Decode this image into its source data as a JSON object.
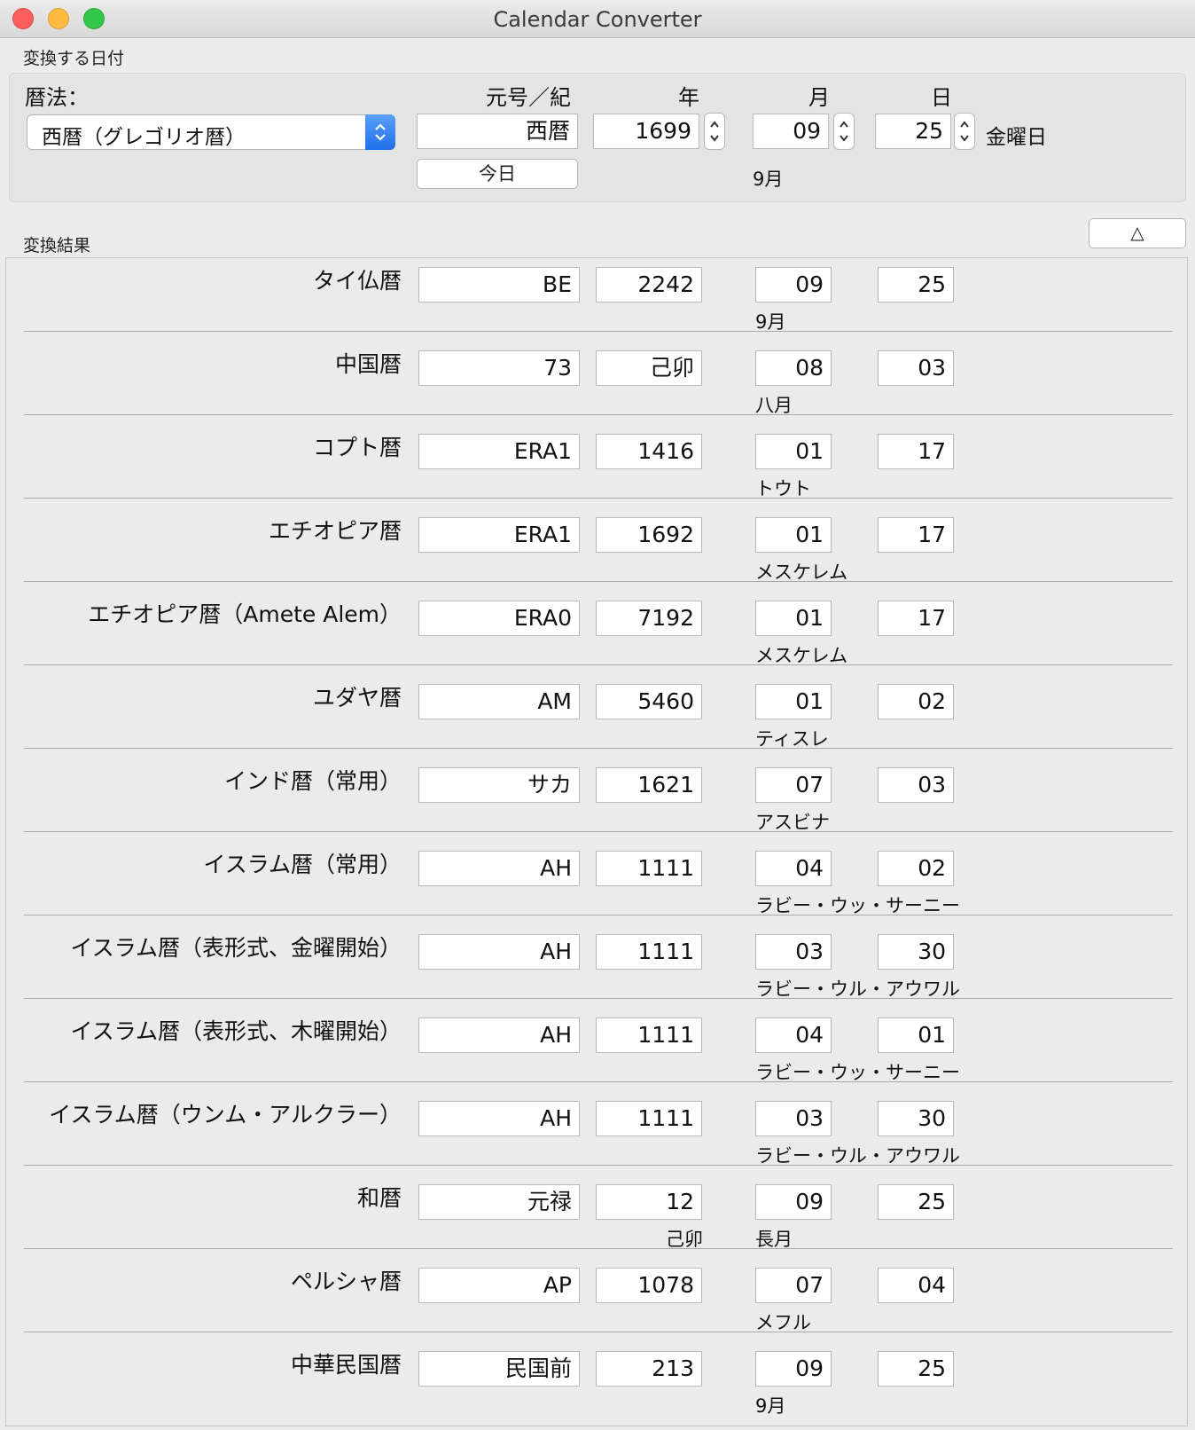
{
  "window": {
    "title": "Calendar Converter"
  },
  "input": {
    "section_label": "変換する日付",
    "calendar_label": "暦法：",
    "era_header": "元号／紀",
    "year_header": "年",
    "month_header": "月",
    "day_header": "日",
    "calendar_selected": "西暦（グレゴリオ暦）",
    "era": "西暦",
    "year": "1699",
    "month": "09",
    "day": "25",
    "weekday": "金曜日",
    "today_button": "今日",
    "month_name": "9月"
  },
  "results": {
    "section_label": "変換結果",
    "collapse_button": "△",
    "rows": [
      {
        "name": "タイ仏暦",
        "era": "BE",
        "year": "2242",
        "month": "09",
        "day": "25",
        "month_name": "9月",
        "year_sub": ""
      },
      {
        "name": "中国暦",
        "era": "73",
        "year": "己卯",
        "month": "08",
        "day": "03",
        "month_name": "八月",
        "year_sub": ""
      },
      {
        "name": "コプト暦",
        "era": "ERA1",
        "year": "1416",
        "month": "01",
        "day": "17",
        "month_name": "トウト",
        "year_sub": ""
      },
      {
        "name": "エチオピア暦",
        "era": "ERA1",
        "year": "1692",
        "month": "01",
        "day": "17",
        "month_name": "メスケレム",
        "year_sub": ""
      },
      {
        "name": "エチオピア暦（Amete Alem）",
        "era": "ERA0",
        "year": "7192",
        "month": "01",
        "day": "17",
        "month_name": "メスケレム",
        "year_sub": ""
      },
      {
        "name": "ユダヤ暦",
        "era": "AM",
        "year": "5460",
        "month": "01",
        "day": "02",
        "month_name": "ティスレ",
        "year_sub": ""
      },
      {
        "name": "インド暦（常用）",
        "era": "サカ",
        "year": "1621",
        "month": "07",
        "day": "03",
        "month_name": "アスビナ",
        "year_sub": ""
      },
      {
        "name": "イスラム暦（常用）",
        "era": "AH",
        "year": "1111",
        "month": "04",
        "day": "02",
        "month_name": "ラビー・ウッ・サーニー",
        "year_sub": ""
      },
      {
        "name": "イスラム暦（表形式、金曜開始）",
        "era": "AH",
        "year": "1111",
        "month": "03",
        "day": "30",
        "month_name": "ラビー・ウル・アウワル",
        "year_sub": ""
      },
      {
        "name": "イスラム暦（表形式、木曜開始）",
        "era": "AH",
        "year": "1111",
        "month": "04",
        "day": "01",
        "month_name": "ラビー・ウッ・サーニー",
        "year_sub": ""
      },
      {
        "name": "イスラム暦（ウンム・アルクラー）",
        "era": "AH",
        "year": "1111",
        "month": "03",
        "day": "30",
        "month_name": "ラビー・ウル・アウワル",
        "year_sub": ""
      },
      {
        "name": "和暦",
        "era": "元禄",
        "year": "12",
        "month": "09",
        "day": "25",
        "month_name": "長月",
        "year_sub": "己卯"
      },
      {
        "name": "ペルシャ暦",
        "era": "AP",
        "year": "1078",
        "month": "07",
        "day": "04",
        "month_name": "メフル",
        "year_sub": ""
      },
      {
        "name": "中華民国暦",
        "era": "民国前",
        "year": "213",
        "month": "09",
        "day": "25",
        "month_name": "9月",
        "year_sub": ""
      }
    ]
  }
}
